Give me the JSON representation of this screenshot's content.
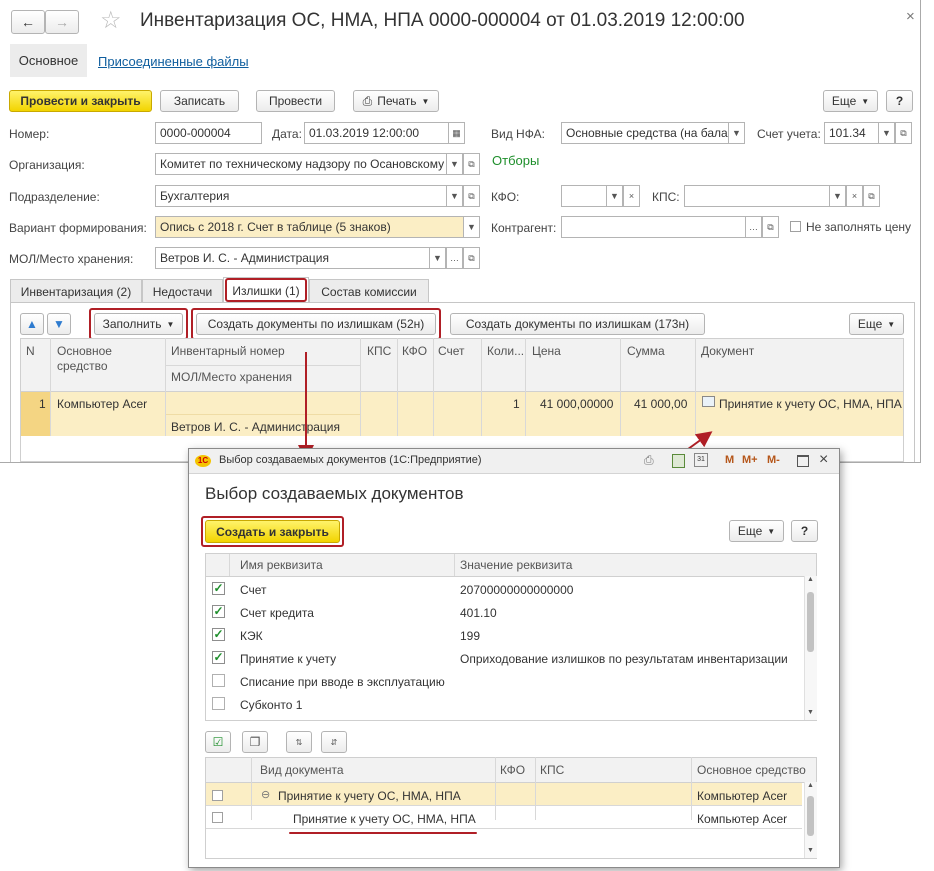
{
  "main_window": {
    "title": "Инвентаризация ОС, НМА, НПА 0000-000004 от 01.03.2019 12:00:00",
    "nav_tabs": [
      "Основное",
      "Присоединенные файлы"
    ],
    "toolbar": {
      "post_close": "Провести и закрыть",
      "save": "Записать",
      "post": "Провести",
      "print": "Печать",
      "more": "Еще",
      "help": "?"
    },
    "fields": {
      "number_label": "Номер:",
      "number_value": "0000-000004",
      "date_label": "Дата:",
      "date_value": "01.03.2019 12:00:00",
      "nfa_label": "Вид НФА:",
      "nfa_value": "Основные средства (на бала",
      "account_label": "Счет учета:",
      "account_value": "101.34",
      "org_label": "Организация:",
      "org_value": "Комитет по техническому надзору по Осановскому",
      "filters_link": "Отборы",
      "dept_label": "Подразделение:",
      "dept_value": "Бухгалтерия",
      "kfo_label": "КФО:",
      "kps_label": "КПС:",
      "variant_label": "Вариант формирования:",
      "variant_value": "Опись с 2018 г. Счет в таблице (5 знаков)",
      "contractor_label": "Контрагент:",
      "no_price_label": "Не заполнять цену",
      "mol_label": "МОЛ/Место хранения:",
      "mol_value": "Ветров И. С. - Администрация"
    },
    "tabs": [
      "Инвентаризация (2)",
      "Недостачи",
      "Излишки (1)",
      "Состав комиссии"
    ],
    "table_toolbar": {
      "fill": "Заполнить",
      "create_52": "Создать документы по излишкам (52н)",
      "create_173": "Создать документы по излишкам (173н)",
      "more": "Еще"
    },
    "columns": [
      "N",
      "Основное средство",
      "Инвентарный номер",
      "МОЛ/Место хранения",
      "КПС",
      "КФО",
      "Счет",
      "Коли...",
      "Цена",
      "Сумма",
      "Документ"
    ],
    "row": {
      "n": "1",
      "asset": "Компьютер  Acer",
      "mol": "Ветров И. С. - Администрация",
      "qty": "1",
      "price": "41 000,00000",
      "sum": "41 000,00",
      "document": "Принятие к учету ОС, НМА, НПА"
    }
  },
  "dialog": {
    "titlebar": "Выбор создаваемых документов  (1С:Предприятие)",
    "titlebar_buttons": [
      "M",
      "M+",
      "M-"
    ],
    "heading": "Выбор создаваемых документов",
    "create_close": "Создать и закрыть",
    "more": "Еще",
    "help": "?",
    "props_columns": [
      "Имя реквизита",
      "Значение реквизита"
    ],
    "props": [
      {
        "name": "Счет",
        "value": "20700000000000000",
        "checked": true
      },
      {
        "name": "Счет кредита",
        "value": "401.10",
        "checked": true
      },
      {
        "name": "КЭК",
        "value": "199",
        "checked": true
      },
      {
        "name": "Принятие к учету",
        "value": "Оприходование излишков по результатам инвентаризации",
        "checked": true
      },
      {
        "name": "Списание при вводе в эксплуатацию",
        "value": "",
        "checked": false
      },
      {
        "name": "Субконто 1",
        "value": "",
        "checked": false
      }
    ],
    "docs_columns": [
      "Вид документа",
      "КФО",
      "КПС",
      "Основное средство"
    ],
    "docs": [
      {
        "type": "Принятие к учету ОС, НМА, НПА",
        "asset": "Компьютер  Acer"
      },
      {
        "type": "Принятие к учету ОС, НМА, НПА",
        "asset": "Компьютер  Acer"
      }
    ]
  },
  "colors": {
    "accent_red": "#b01f26",
    "yellow_button": "#f5dc1a",
    "selection": "#fbeec5",
    "link": "#0f5e9e",
    "green": "#1f8f2c"
  }
}
